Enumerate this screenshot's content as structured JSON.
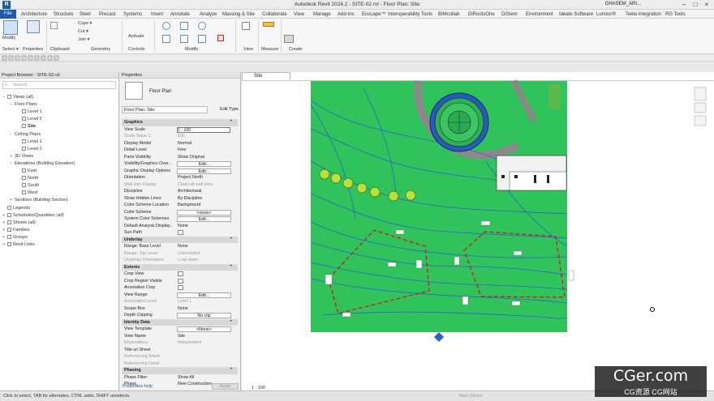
{
  "titlebar": {
    "title": "Autodesk Revit 2024.2 - SITE-02.rvt - Floor Plan: Site",
    "user": "GHASEM_ARI..."
  },
  "tabs": [
    "File",
    "Architecture",
    "Structure",
    "Steel",
    "Precast",
    "Systems",
    "Insert",
    "Annotate",
    "Analyze",
    "Massing & Site",
    "Collaborate",
    "View",
    "Manage",
    "Add-Ins",
    "Enscape™",
    "Interoperability Tools",
    "BIMcollab",
    "DiRootsOne",
    "DiStem",
    "Environment",
    "Ideate Software",
    "Lumion®",
    "Tekla Integration",
    "RG Tools"
  ],
  "ribbon": {
    "modify_label": "Modify",
    "select_label": "Select ▾",
    "panels": [
      "Properties",
      "Clipboard",
      "Geometry",
      "Controls",
      "Modify",
      "View",
      "Measure",
      "Create"
    ],
    "clipboard_items": [
      "Cope ▾",
      "Cut ▾",
      "Join ▾"
    ],
    "activate_label": "Activate"
  },
  "project_browser": {
    "header": "Project Browser - SITE-02.rvt",
    "search_placeholder": "Search",
    "items": [
      {
        "label": "Views (all)",
        "level": 0,
        "icon": "views",
        "expander": "−"
      },
      {
        "label": "Floor Plans",
        "level": 1,
        "icon": "none",
        "expander": "−"
      },
      {
        "label": "Level 1",
        "level": 2,
        "icon": "plan",
        "expander": ""
      },
      {
        "label": "Level 2",
        "level": 2,
        "icon": "plan",
        "expander": ""
      },
      {
        "label": "Site",
        "level": 2,
        "icon": "plan",
        "expander": "",
        "active": true
      },
      {
        "label": "Ceiling Plans",
        "level": 1,
        "icon": "none",
        "expander": "−"
      },
      {
        "label": "Level 1",
        "level": 2,
        "icon": "plan",
        "expander": ""
      },
      {
        "label": "Level 2",
        "level": 2,
        "icon": "plan",
        "expander": ""
      },
      {
        "label": "3D Views",
        "level": 1,
        "icon": "none",
        "expander": "+"
      },
      {
        "label": "Elevations (Building Elevation)",
        "level": 1,
        "icon": "none",
        "expander": "−"
      },
      {
        "label": "East",
        "level": 2,
        "icon": "plan",
        "expander": ""
      },
      {
        "label": "North",
        "level": 2,
        "icon": "plan",
        "expander": ""
      },
      {
        "label": "South",
        "level": 2,
        "icon": "plan",
        "expander": ""
      },
      {
        "label": "West",
        "level": 2,
        "icon": "plan",
        "expander": ""
      },
      {
        "label": "Sections (Building Section)",
        "level": 1,
        "icon": "none",
        "expander": "+"
      },
      {
        "label": "Legends",
        "level": 0,
        "icon": "legend",
        "expander": ""
      },
      {
        "label": "Schedules/Quantities (all)",
        "level": 0,
        "icon": "schedule",
        "expander": "+"
      },
      {
        "label": "Sheets (all)",
        "level": 0,
        "icon": "sheet",
        "expander": "+"
      },
      {
        "label": "Families",
        "level": 0,
        "icon": "family",
        "expander": "+"
      },
      {
        "label": "Groups",
        "level": 0,
        "icon": "group",
        "expander": "+"
      },
      {
        "label": "Revit Links",
        "level": 0,
        "icon": "link",
        "expander": "∞"
      }
    ]
  },
  "properties": {
    "header": "Properties",
    "type_name": "Floor Plan",
    "selector": "Floor Plan: Site",
    "edit_type": "Edit Type",
    "rows": [
      {
        "kind": "sec",
        "k": "Graphics"
      },
      {
        "k": "View Scale",
        "v": "1 : 100",
        "input": true
      },
      {
        "k": "Scale Value    1:",
        "v": "100",
        "dim": true
      },
      {
        "k": "Display Model",
        "v": "Normal"
      },
      {
        "k": "Detail Level",
        "v": "Fine"
      },
      {
        "k": "Parts Visibility",
        "v": "Show Original"
      },
      {
        "k": "Visibility/Graphics Over...",
        "v": "Edit...",
        "btn": true
      },
      {
        "k": "Graphic Display Options",
        "v": "Edit...",
        "btn": true
      },
      {
        "k": "Orientation",
        "v": "Project North"
      },
      {
        "k": "Wall Join Display",
        "v": "Clean all wall joins",
        "dim": true
      },
      {
        "k": "Discipline",
        "v": "Architectural"
      },
      {
        "k": "Show Hidden Lines",
        "v": "By Discipline"
      },
      {
        "k": "Color Scheme Location",
        "v": "Background"
      },
      {
        "k": "Color Scheme",
        "v": "<none>",
        "btn": true
      },
      {
        "k": "System Color Schemes",
        "v": "Edit...",
        "btn": true
      },
      {
        "k": "Default Analysis Display...",
        "v": "None"
      },
      {
        "k": "Sun Path",
        "v": "",
        "check": true
      },
      {
        "kind": "sec",
        "k": "Underlay"
      },
      {
        "k": "Range: Base Level",
        "v": "None"
      },
      {
        "k": "Range: Top Level",
        "v": "Unbounded",
        "dim": true
      },
      {
        "k": "Underlay Orientation",
        "v": "Look down",
        "dim": true
      },
      {
        "kind": "sec",
        "k": "Extents"
      },
      {
        "k": "Crop View",
        "v": "",
        "check": true
      },
      {
        "k": "Crop Region Visible",
        "v": "",
        "check": true
      },
      {
        "k": "Annotation Crop",
        "v": "",
        "check": true
      },
      {
        "k": "View Range",
        "v": "Edit...",
        "btn": true
      },
      {
        "k": "Associated Level",
        "v": "Level 1",
        "dim": true
      },
      {
        "k": "Scope Box",
        "v": "None"
      },
      {
        "k": "Depth Clipping",
        "v": "No clip",
        "btn": true
      },
      {
        "kind": "sec",
        "k": "Identity Data"
      },
      {
        "k": "View Template",
        "v": "<None>",
        "btn": true
      },
      {
        "k": "View Name",
        "v": "Site"
      },
      {
        "k": "Dependency",
        "v": "Independent",
        "dim": true
      },
      {
        "k": "Title on Sheet",
        "v": ""
      },
      {
        "k": "Referencing Sheet",
        "v": "",
        "dim": true
      },
      {
        "k": "Referencing Detail",
        "v": "",
        "dim": true
      },
      {
        "kind": "sec",
        "k": "Phasing"
      },
      {
        "k": "Phase Filter",
        "v": "Show All"
      },
      {
        "k": "Phase",
        "v": "New Construction"
      }
    ],
    "help_link": "Properties help",
    "apply": "Apply"
  },
  "view": {
    "tab_label": "Site",
    "scale": "1 : 100",
    "model_label": "Main Model"
  },
  "status": {
    "text": "Click to select, TAB for alternates, CTRL adds, SHIFT unselects."
  },
  "watermark": {
    "main": "CGer.com",
    "sub": "CG资源 CG网站"
  },
  "colors": {
    "terrain": "#2fc45a",
    "contour": "#2a62c9",
    "boundary": "#c8211c",
    "accent": "#1c5cab"
  }
}
